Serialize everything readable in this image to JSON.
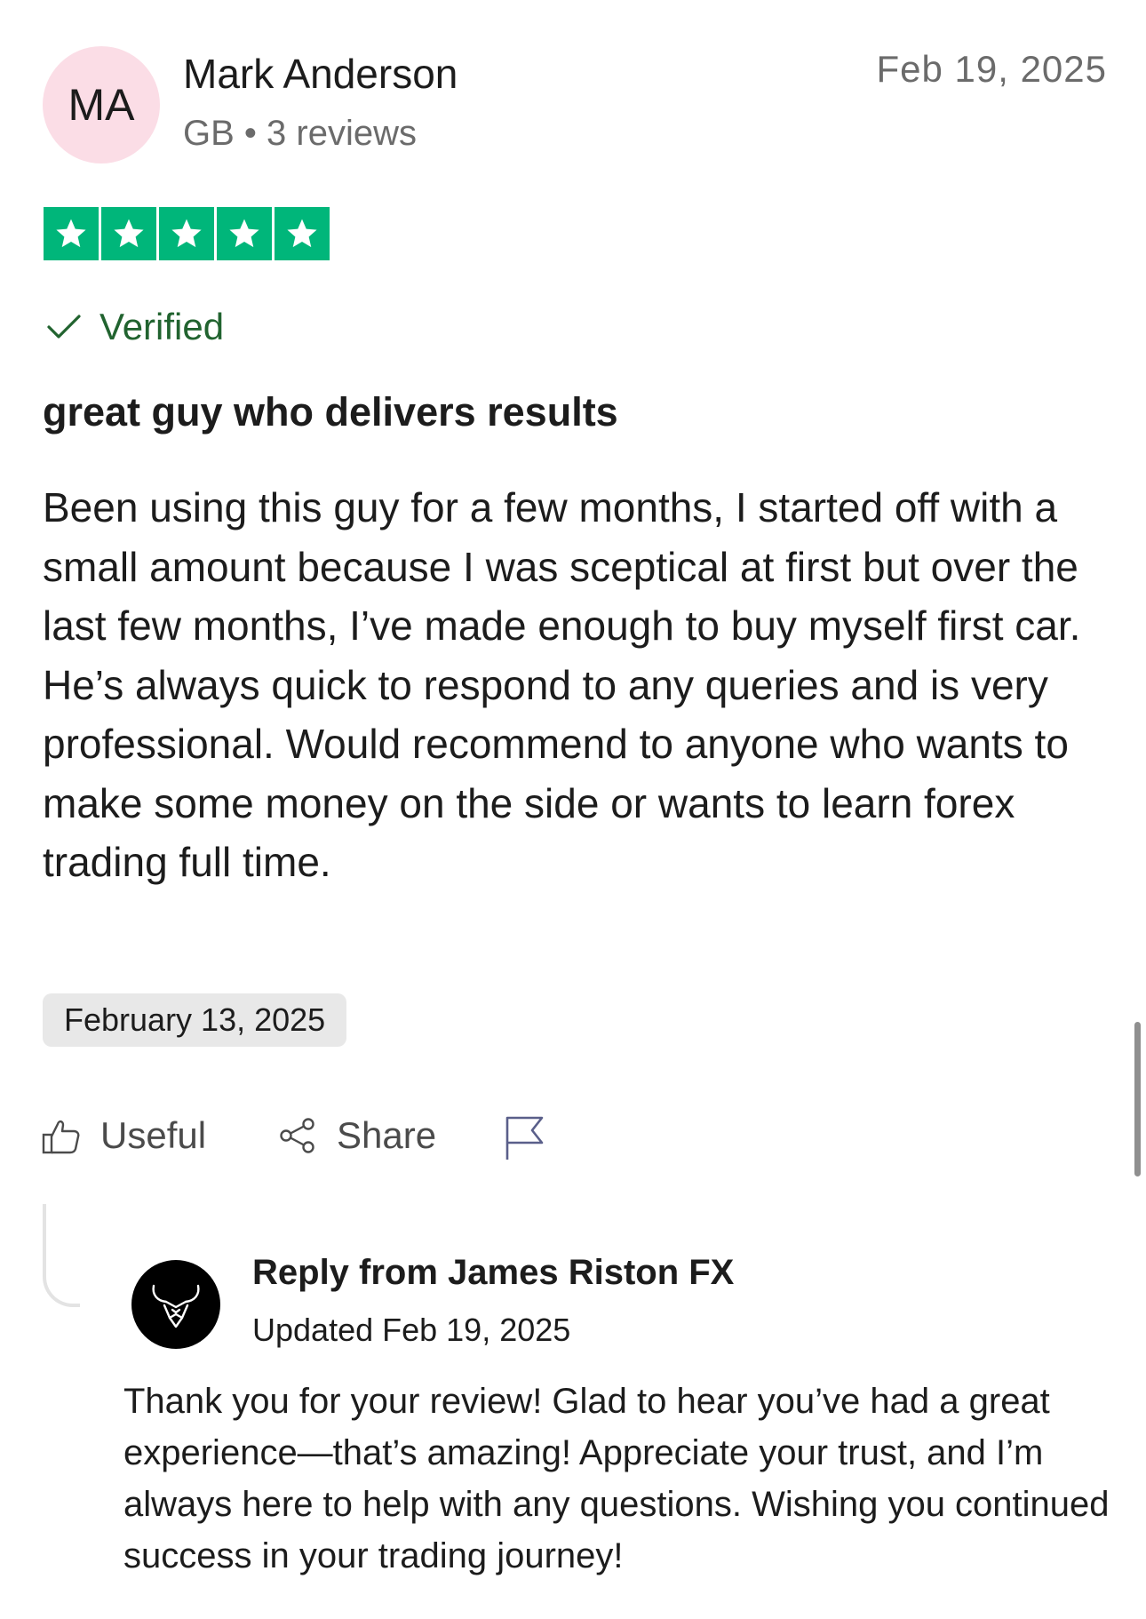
{
  "reviewer": {
    "initials": "MA",
    "name": "Mark Anderson",
    "meta": "GB • 3 reviews"
  },
  "review_date": "Feb 19, 2025",
  "rating": {
    "stars": 5,
    "max": 5,
    "color": "#00b67a"
  },
  "verified_label": "Verified",
  "title": "great guy who delivers results",
  "body": "Been using this guy for a few months, I started off with a small amount because I was sceptical at first but over the last few months, I’ve made enough to buy myself first car. He’s always quick to respond to any queries and is very professional. Would recommend to anyone who wants to make some money on the side or wants to learn forex trading full time.",
  "experience_date": "February 13, 2025",
  "actions": {
    "useful": "Useful",
    "share": "Share",
    "useful_icon": "thumbs-up-icon",
    "share_icon": "share-icon",
    "report_icon": "flag-icon"
  },
  "reply": {
    "title": "Reply from James Riston FX",
    "updated": "Updated Feb 19, 2025",
    "body": "Thank you for your review! Glad to hear you’ve had a great experience—that’s amazing! Appreciate your trust, and I’m always here to help with any questions. Wishing you continued success in your trading journey!",
    "logo_icon": "bull-head-logo"
  }
}
